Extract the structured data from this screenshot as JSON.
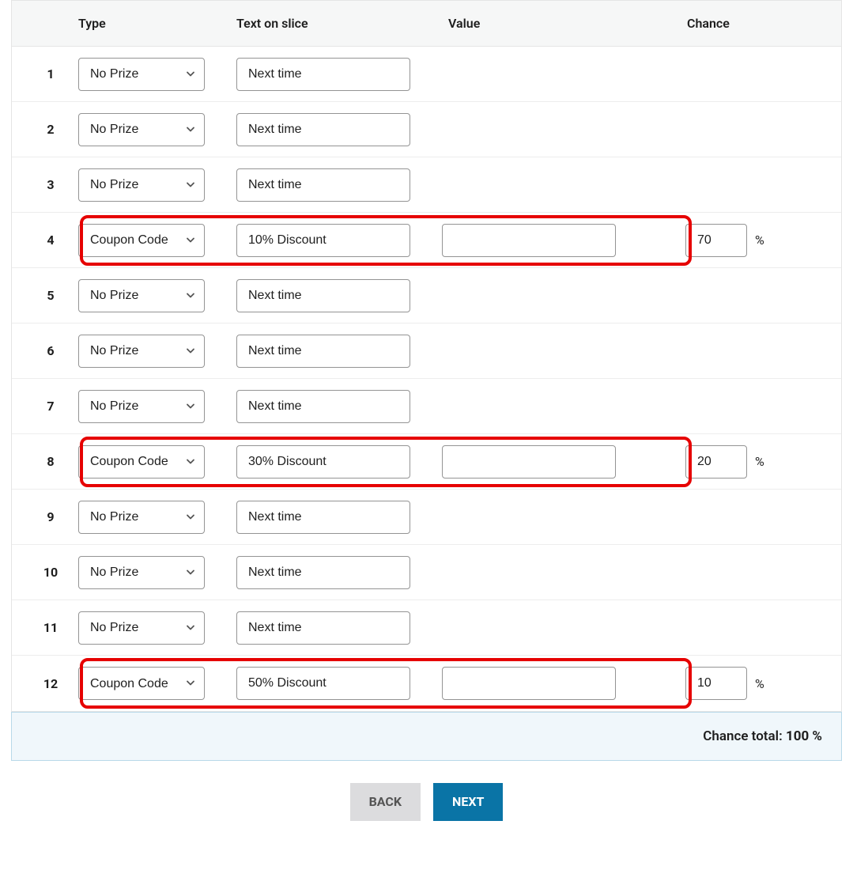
{
  "headers": {
    "type": "Type",
    "text": "Text on slice",
    "value": "Value",
    "chance": "Chance"
  },
  "options": {
    "no_prize": "No Prize",
    "coupon_code": "Coupon Code"
  },
  "percent_symbol": "%",
  "rows": [
    {
      "num": "1",
      "type": "no_prize",
      "text": "Next time",
      "value": null,
      "chance": null,
      "bordered": false
    },
    {
      "num": "2",
      "type": "no_prize",
      "text": "Next time",
      "value": null,
      "chance": null,
      "bordered": false
    },
    {
      "num": "3",
      "type": "no_prize",
      "text": "Next time",
      "value": null,
      "chance": null,
      "bordered": false
    },
    {
      "num": "4",
      "type": "coupon_code",
      "text": "10% Discount",
      "value": "",
      "chance": "70",
      "bordered": true
    },
    {
      "num": "5",
      "type": "no_prize",
      "text": "Next time",
      "value": null,
      "chance": null,
      "bordered": false
    },
    {
      "num": "6",
      "type": "no_prize",
      "text": "Next time",
      "value": null,
      "chance": null,
      "bordered": false
    },
    {
      "num": "7",
      "type": "no_prize",
      "text": "Next time",
      "value": null,
      "chance": null,
      "bordered": false
    },
    {
      "num": "8",
      "type": "coupon_code",
      "text": "30% Discount",
      "value": "",
      "chance": "20",
      "bordered": true
    },
    {
      "num": "9",
      "type": "no_prize",
      "text": "Next time",
      "value": null,
      "chance": null,
      "bordered": false
    },
    {
      "num": "10",
      "type": "no_prize",
      "text": "Next time",
      "value": null,
      "chance": null,
      "bordered": false
    },
    {
      "num": "11",
      "type": "no_prize",
      "text": "Next time",
      "value": null,
      "chance": null,
      "bordered": false
    },
    {
      "num": "12",
      "type": "coupon_code",
      "text": "50% Discount",
      "value": "",
      "chance": "10",
      "bordered": true
    }
  ],
  "footer": {
    "label": "Chance total: ",
    "value": "100 %"
  },
  "buttons": {
    "back": "BACK",
    "next": "NEXT"
  }
}
